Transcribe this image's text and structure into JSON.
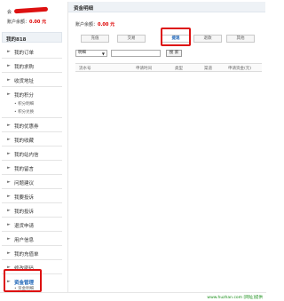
{
  "user": {
    "name_prefix": "会",
    "balance_label": "账户余额：",
    "balance_value": "0.00 元"
  },
  "sidebar": {
    "title": "我的818",
    "items": [
      {
        "label": "我的订单"
      },
      {
        "label": "我的求购"
      },
      {
        "label": "收货地址"
      },
      {
        "label": "我的积分",
        "children": [
          {
            "label": "积分明细"
          },
          {
            "label": "积分兑换"
          }
        ]
      },
      {
        "label": "我的优惠券"
      },
      {
        "label": "我的收藏"
      },
      {
        "label": "我的站内信"
      },
      {
        "label": "我的留言"
      },
      {
        "label": "问题建议"
      },
      {
        "label": "我要投诉"
      },
      {
        "label": "我的投诉"
      },
      {
        "label": "退货申请"
      },
      {
        "label": "用户信息"
      },
      {
        "label": "我的充值单"
      },
      {
        "label": "修改密码"
      },
      {
        "label": "资金管理",
        "active": true,
        "children": [
          {
            "label": "资金明细"
          }
        ]
      }
    ]
  },
  "main": {
    "title": "资金明细",
    "balance_label": "账户余额：",
    "balance_value": "0.00 元",
    "tabs": [
      {
        "label": "充值"
      },
      {
        "label": "交易"
      },
      {
        "label": "提现",
        "active": true
      },
      {
        "label": "退款"
      },
      {
        "label": "其他"
      }
    ],
    "filter": {
      "select_value": "明细",
      "search_placeholder": "",
      "search_button": "搜 索"
    },
    "table": {
      "columns": [
        "流水号",
        "申请时间",
        "类型",
        "渠道",
        "申请资金(元)"
      ]
    }
  },
  "footer": {
    "text": "www.huzhan.com [网址]提供"
  },
  "colors": {
    "accent": "#1a62b6",
    "highlight": "#dd1111",
    "money": "#dd0000"
  }
}
